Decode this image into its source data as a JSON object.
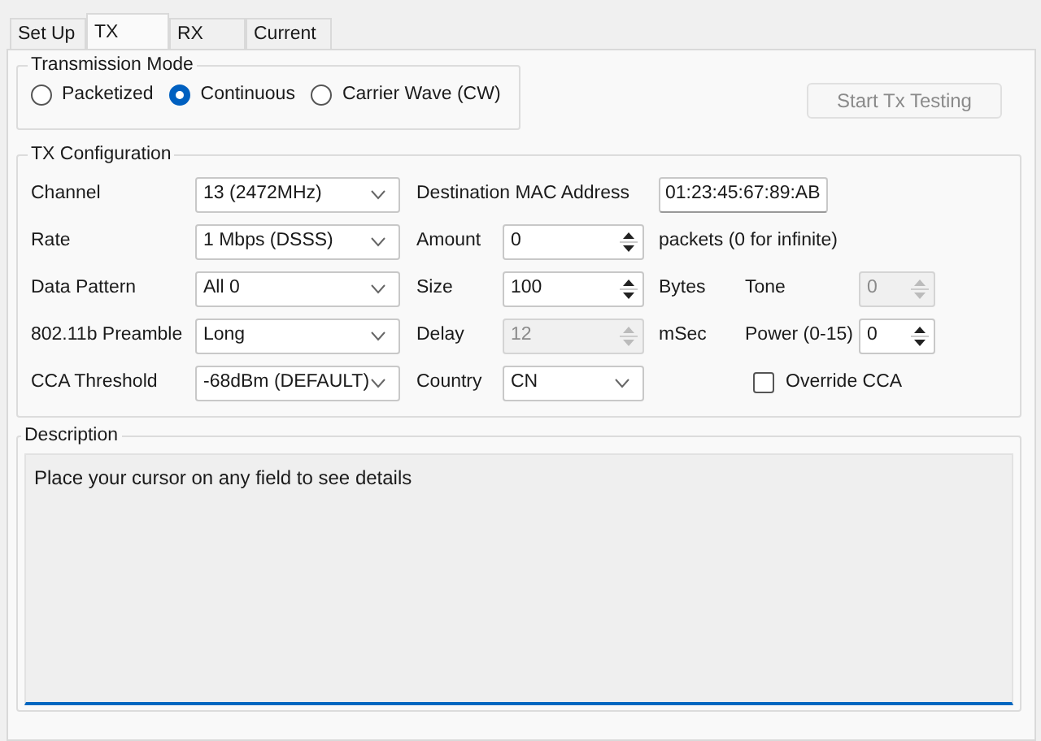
{
  "tabs": [
    {
      "label": "Set Up",
      "selected": false
    },
    {
      "label": "TX",
      "selected": true
    },
    {
      "label": "RX",
      "selected": false
    },
    {
      "label": "Current",
      "selected": false
    }
  ],
  "transmission_mode": {
    "title": "Transmission Mode",
    "options": [
      {
        "label": "Packetized",
        "selected": false
      },
      {
        "label": "Continuous",
        "selected": true
      },
      {
        "label": "Carrier Wave (CW)",
        "selected": false
      }
    ]
  },
  "start_button": {
    "label": "Start Tx Testing",
    "disabled": true
  },
  "tx_configuration": {
    "title": "TX Configuration",
    "rows": [
      [
        {
          "kind": "label",
          "text": "Channel"
        },
        {
          "kind": "combo",
          "value": "13 (2472MHz)"
        },
        {
          "kind": "label",
          "text": "Destination MAC Address"
        },
        "",
        {
          "kind": "text",
          "value": "01:23:45:67:89:AB"
        }
      ],
      [
        {
          "kind": "label",
          "text": "Rate"
        },
        {
          "kind": "combo",
          "value": "1 Mbps (DSSS)"
        },
        {
          "kind": "label",
          "text": "Amount"
        },
        {
          "kind": "spin",
          "value": "0",
          "disabled": false
        },
        {
          "kind": "label",
          "text": "packets (0 for infinite)"
        }
      ],
      [
        {
          "kind": "label",
          "text": "Data Pattern"
        },
        {
          "kind": "combo",
          "value": "All 0"
        },
        {
          "kind": "label",
          "text": "Size"
        },
        {
          "kind": "spin",
          "value": "100",
          "disabled": false
        },
        {
          "kind": "label",
          "text": "Bytes"
        },
        {
          "kind": "label",
          "text": "Tone"
        },
        {
          "kind": "spin",
          "value": "0",
          "disabled": true
        }
      ],
      [
        {
          "kind": "label",
          "text": "802.11b Preamble"
        },
        {
          "kind": "combo",
          "value": "Long"
        },
        {
          "kind": "label",
          "text": "Delay"
        },
        {
          "kind": "spin",
          "value": "12",
          "disabled": true
        },
        {
          "kind": "label",
          "text": "mSec"
        },
        {
          "kind": "label",
          "text": "Power (0-15)"
        },
        {
          "kind": "spin",
          "value": "0",
          "disabled": false
        }
      ],
      [
        {
          "kind": "label",
          "text": "CCA Threshold"
        },
        {
          "kind": "combo",
          "value": "-68dBm (DEFAULT)"
        },
        {
          "kind": "label",
          "text": "Country"
        },
        {
          "kind": "combo",
          "value": "CN"
        },
        "",
        {
          "kind": "checkbox",
          "label": "Override CCA",
          "checked": false
        }
      ]
    ]
  },
  "description": {
    "title": "Description",
    "text": "Place your cursor on any field to see details"
  }
}
